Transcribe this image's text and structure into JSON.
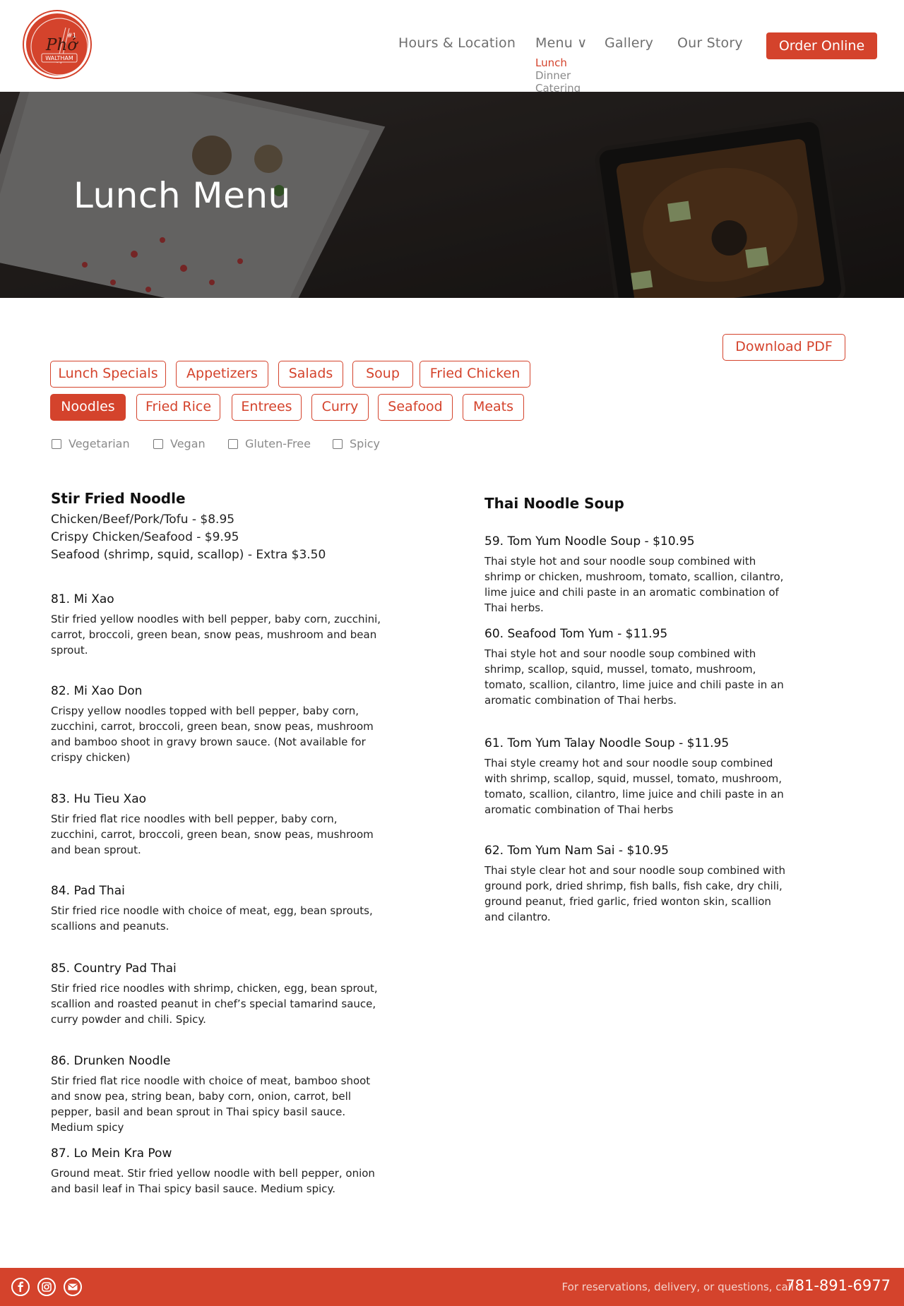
{
  "header": {
    "logo_text": "Phở",
    "logo_sub": "WALTHAM",
    "logo_number": "#1",
    "nav": {
      "hours": "Hours & Location",
      "menu": "Menu ∨",
      "gallery": "Gallery",
      "story": "Our Story",
      "order": "Order Online"
    },
    "submenu": [
      "Lunch",
      "Dinner",
      "Catering"
    ]
  },
  "hero": {
    "title": "Lunch Menu"
  },
  "download_pdf": "Download PDF",
  "tabs": [
    "Lunch Specials",
    "Appetizers",
    "Salads",
    "Soup",
    "Fried Chicken",
    "Noodles",
    "Fried Rice",
    "Entrees",
    "Curry",
    "Seafood",
    "Meats"
  ],
  "active_tab": "Noodles",
  "filters": [
    "Vegetarian",
    "Vegan",
    "Gluten-Free",
    "Spicy"
  ],
  "left": {
    "title": "Stir Fried Noodle",
    "prices": [
      "Chicken/Beef/Pork/Tofu - $8.95",
      "Crispy Chicken/Seafood - $9.95",
      "Seafood (shrimp, squid, scallop) - Extra $3.50"
    ],
    "items": [
      {
        "name": "81. Mi Xao",
        "desc": "Stir fried yellow noodles with bell pepper, baby corn, zucchini, carrot, broccoli, green bean, snow peas, mushroom and bean sprout."
      },
      {
        "name": "82. Mi Xao Don",
        "desc": "Crispy yellow noodles topped with bell pepper, baby corn, zucchini, carrot, broccoli, green bean, snow peas, mushroom and bamboo shoot in gravy brown sauce. (Not available for crispy chicken)"
      },
      {
        "name": "83. Hu Tieu Xao",
        "desc": "Stir fried flat rice noodles with bell pepper, baby corn, zucchini, carrot, broccoli, green bean, snow peas, mushroom and bean sprout."
      },
      {
        "name": "84. Pad Thai",
        "desc": "Stir fried rice noodle with choice of meat, egg, bean sprouts, scallions and peanuts."
      },
      {
        "name": "85. Country Pad Thai",
        "desc": "Stir fried rice noodles with shrimp, chicken, egg, bean sprout, scallion and roasted peanut in chef’s special tamarind sauce, curry powder and chili. Spicy."
      },
      {
        "name": "86. Drunken Noodle",
        "desc": "Stir fried flat rice noodle with choice of meat, bamboo shoot and snow pea, string bean, baby corn, onion, carrot, bell pepper, basil and bean sprout in Thai spicy basil sauce. Medium spicy"
      },
      {
        "name": "87. Lo Mein Kra Pow",
        "desc": "Ground meat. Stir fried yellow noodle with bell pepper, onion and basil leaf in Thai spicy basil sauce. Medium spicy."
      }
    ]
  },
  "right": {
    "title": "Thai Noodle Soup",
    "items": [
      {
        "name": "59.  Tom Yum Noodle Soup - $10.95",
        "desc": "Thai style hot and sour noodle soup combined with shrimp or chicken, mushroom, tomato, scallion, cilantro, lime juice and chili paste in an aromatic combination of Thai herbs."
      },
      {
        "name": "60. Seafood Tom Yum - $11.95",
        "desc": "Thai style hot and sour noodle soup combined with shrimp, scallop, squid, mussel, tomato, mushroom, tomato, scallion, cilantro, lime juice and chili paste in an aromatic combination of Thai herbs."
      },
      {
        "name": "61. Tom Yum Talay Noodle Soup - $11.95",
        "desc": "Thai style creamy hot and sour noodle soup combined with shrimp, scallop, squid, mussel, tomato, mushroom, tomato, scallion, cilantro, lime juice and chili paste in an aromatic combination of Thai herbs"
      },
      {
        "name": "62. Tom Yum Nam Sai - $10.95",
        "desc": "Thai style clear hot and sour noodle soup combined with ground pork, dried shrimp, fish balls, fish cake, dry chili, ground peanut, fried garlic, fried wonton skin, scallion and cilantro."
      }
    ]
  },
  "footer": {
    "social": [
      "facebook-icon",
      "instagram-icon",
      "email-icon"
    ],
    "note": "For reservations, delivery, or questions, call",
    "phone": "781-891-6977"
  },
  "colors": {
    "accent": "#d4432c",
    "hero_bg": "#2f2a27"
  }
}
